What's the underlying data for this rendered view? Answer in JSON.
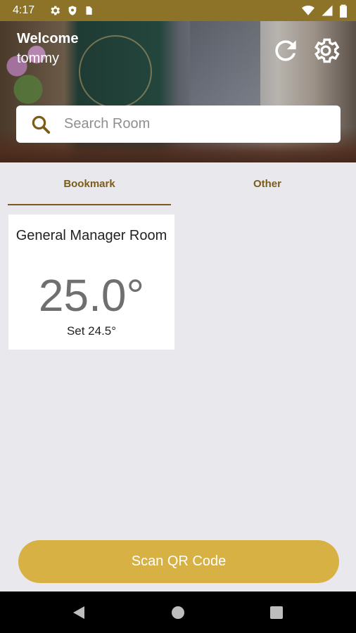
{
  "status_bar": {
    "time": "4:17",
    "left_icons": [
      "gear-icon",
      "shield-icon",
      "sd-card-icon"
    ],
    "right_icons": [
      "wifi-icon",
      "signal-icon",
      "battery-icon"
    ]
  },
  "header": {
    "welcome": "Welcome",
    "username": "tommy",
    "actions": [
      "refresh-icon",
      "settings-icon"
    ]
  },
  "search": {
    "placeholder": "Search Room"
  },
  "tabs": [
    {
      "label": "Bookmark",
      "selected": true
    },
    {
      "label": "Other",
      "selected": false
    }
  ],
  "rooms": [
    {
      "name": "General Manager Room",
      "temperature": "25.0°",
      "setpoint": "Set 24.5°"
    }
  ],
  "scan_button": {
    "label": "Scan QR Code"
  },
  "colors": {
    "accent": "#7a5d18",
    "status_bar": "#8c7327",
    "button": "#d7b144",
    "background": "#e9e8ec"
  }
}
